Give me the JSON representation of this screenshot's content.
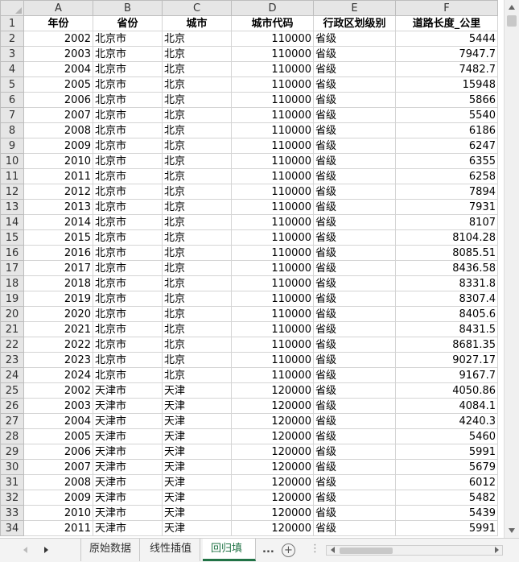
{
  "columns": [
    "A",
    "B",
    "C",
    "D",
    "E",
    "F"
  ],
  "header_row": {
    "row_num": "1",
    "cells": [
      "年份",
      "省份",
      "城市",
      "城市代码",
      "行政区划级别",
      "道路长度_公里"
    ]
  },
  "rows": [
    {
      "n": "2",
      "cells": [
        "2002",
        "北京市",
        "北京",
        "110000",
        "省级",
        "5444"
      ]
    },
    {
      "n": "3",
      "cells": [
        "2003",
        "北京市",
        "北京",
        "110000",
        "省级",
        "7947.7"
      ]
    },
    {
      "n": "4",
      "cells": [
        "2004",
        "北京市",
        "北京",
        "110000",
        "省级",
        "7482.7"
      ]
    },
    {
      "n": "5",
      "cells": [
        "2005",
        "北京市",
        "北京",
        "110000",
        "省级",
        "15948"
      ]
    },
    {
      "n": "6",
      "cells": [
        "2006",
        "北京市",
        "北京",
        "110000",
        "省级",
        "5866"
      ]
    },
    {
      "n": "7",
      "cells": [
        "2007",
        "北京市",
        "北京",
        "110000",
        "省级",
        "5540"
      ]
    },
    {
      "n": "8",
      "cells": [
        "2008",
        "北京市",
        "北京",
        "110000",
        "省级",
        "6186"
      ]
    },
    {
      "n": "9",
      "cells": [
        "2009",
        "北京市",
        "北京",
        "110000",
        "省级",
        "6247"
      ]
    },
    {
      "n": "10",
      "cells": [
        "2010",
        "北京市",
        "北京",
        "110000",
        "省级",
        "6355"
      ]
    },
    {
      "n": "11",
      "cells": [
        "2011",
        "北京市",
        "北京",
        "110000",
        "省级",
        "6258"
      ]
    },
    {
      "n": "12",
      "cells": [
        "2012",
        "北京市",
        "北京",
        "110000",
        "省级",
        "7894"
      ]
    },
    {
      "n": "13",
      "cells": [
        "2013",
        "北京市",
        "北京",
        "110000",
        "省级",
        "7931"
      ]
    },
    {
      "n": "14",
      "cells": [
        "2014",
        "北京市",
        "北京",
        "110000",
        "省级",
        "8107"
      ]
    },
    {
      "n": "15",
      "cells": [
        "2015",
        "北京市",
        "北京",
        "110000",
        "省级",
        "8104.28"
      ]
    },
    {
      "n": "16",
      "cells": [
        "2016",
        "北京市",
        "北京",
        "110000",
        "省级",
        "8085.51"
      ]
    },
    {
      "n": "17",
      "cells": [
        "2017",
        "北京市",
        "北京",
        "110000",
        "省级",
        "8436.58"
      ]
    },
    {
      "n": "18",
      "cells": [
        "2018",
        "北京市",
        "北京",
        "110000",
        "省级",
        "8331.8"
      ]
    },
    {
      "n": "19",
      "cells": [
        "2019",
        "北京市",
        "北京",
        "110000",
        "省级",
        "8307.4"
      ]
    },
    {
      "n": "20",
      "cells": [
        "2020",
        "北京市",
        "北京",
        "110000",
        "省级",
        "8405.6"
      ]
    },
    {
      "n": "21",
      "cells": [
        "2021",
        "北京市",
        "北京",
        "110000",
        "省级",
        "8431.5"
      ]
    },
    {
      "n": "22",
      "cells": [
        "2022",
        "北京市",
        "北京",
        "110000",
        "省级",
        "8681.35"
      ]
    },
    {
      "n": "23",
      "cells": [
        "2023",
        "北京市",
        "北京",
        "110000",
        "省级",
        "9027.17"
      ]
    },
    {
      "n": "24",
      "cells": [
        "2024",
        "北京市",
        "北京",
        "110000",
        "省级",
        "9167.7"
      ]
    },
    {
      "n": "25",
      "cells": [
        "2002",
        "天津市",
        "天津",
        "120000",
        "省级",
        "4050.86"
      ]
    },
    {
      "n": "26",
      "cells": [
        "2003",
        "天津市",
        "天津",
        "120000",
        "省级",
        "4084.1"
      ]
    },
    {
      "n": "27",
      "cells": [
        "2004",
        "天津市",
        "天津",
        "120000",
        "省级",
        "4240.3"
      ]
    },
    {
      "n": "28",
      "cells": [
        "2005",
        "天津市",
        "天津",
        "120000",
        "省级",
        "5460"
      ]
    },
    {
      "n": "29",
      "cells": [
        "2006",
        "天津市",
        "天津",
        "120000",
        "省级",
        "5991"
      ]
    },
    {
      "n": "30",
      "cells": [
        "2007",
        "天津市",
        "天津",
        "120000",
        "省级",
        "5679"
      ]
    },
    {
      "n": "31",
      "cells": [
        "2008",
        "天津市",
        "天津",
        "120000",
        "省级",
        "6012"
      ]
    },
    {
      "n": "32",
      "cells": [
        "2009",
        "天津市",
        "天津",
        "120000",
        "省级",
        "5482"
      ]
    },
    {
      "n": "33",
      "cells": [
        "2010",
        "天津市",
        "天津",
        "120000",
        "省级",
        "5439"
      ]
    },
    {
      "n": "34",
      "cells": [
        "2011",
        "天津市",
        "天津",
        "120000",
        "省级",
        "5991"
      ]
    }
  ],
  "sheet_tabs": [
    "原始数据",
    "线性插值",
    "回归填补"
  ],
  "active_tab_index": 2,
  "tab_overflow": "...",
  "add_sheet_symbol": "+",
  "more_options_symbol": "⋮",
  "accent_color": "#217346",
  "icons": {
    "scroll_up": "triangle-up",
    "scroll_down": "triangle-down",
    "tab_prev": "triangle-left",
    "tab_next": "triangle-right",
    "hscroll_left": "triangle-left",
    "hscroll_right": "triangle-right"
  }
}
